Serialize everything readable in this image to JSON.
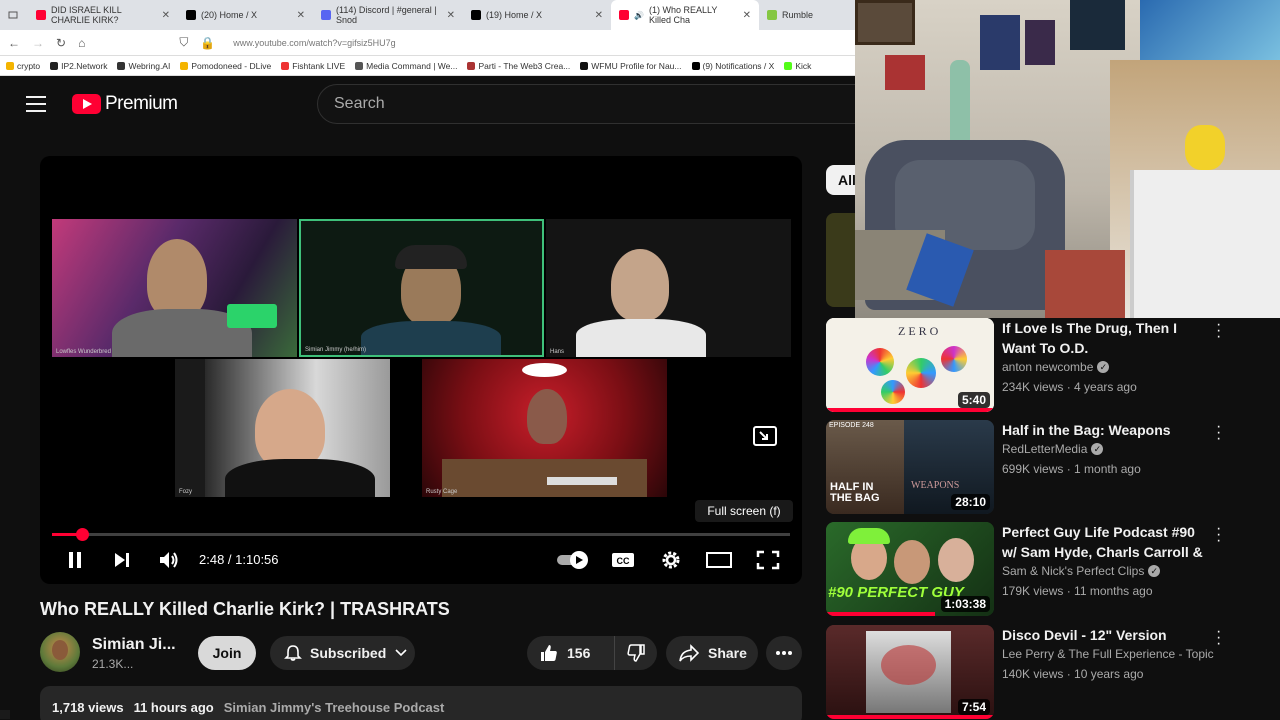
{
  "browser": {
    "tabs": [
      {
        "label": "DID ISRAEL KILL CHARLIE KIRK?"
      },
      {
        "label": "(20) Home / X"
      },
      {
        "label": "(114) Discord | #general | Snod"
      },
      {
        "label": "(19) Home / X"
      },
      {
        "label": "(1) Who REALLY Killed Cha"
      },
      {
        "label": "Rumble"
      }
    ],
    "url": "www.youtube.com/watch?v=gifsiz5HU7g",
    "bookmarks": [
      "crypto",
      "IP2.Network",
      "Webring.AI",
      "Pomodoneed - DLive",
      "Fishtank LIVE",
      "Media Command | We...",
      "Parti - The Web3 Crea...",
      "WFMU Profile for Nau...",
      "(9) Notifications / X",
      "Kick"
    ]
  },
  "header": {
    "logo_text": "Premium",
    "search_placeholder": "Search"
  },
  "player": {
    "participants": [
      "Lowfles Wunderbred",
      "Simian Jimmy (he/him)",
      "Hans",
      "Fozy",
      "Rusty Cage"
    ],
    "tooltip": "Full screen (f)",
    "time": "2:48 / 1:10:56",
    "progress": 0.04,
    "icons": [
      "pause-icon",
      "next-icon",
      "volume-icon",
      "autoplay-toggle-icon",
      "captions-icon",
      "settings-icon",
      "theater-icon",
      "fullscreen-icon",
      "miniplayer-icon"
    ]
  },
  "video": {
    "title": "Who REALLY Killed Charlie Kirk? | TRASHRATS",
    "channel": "Simian Ji...",
    "subscribers": "21.3K...",
    "join_label": "Join",
    "subscribed_label": "Subscribed",
    "likes": "156",
    "share_label": "Share",
    "views": "1,718 views",
    "age": "11 hours ago",
    "description_tag": "Simian Jimmy's Treehouse Podcast"
  },
  "sidebar": {
    "chip": "All",
    "recommendations": [
      {
        "title": "If Love Is The Drug, Then I Want To O.D.",
        "channel": "anton newcombe",
        "verified": true,
        "meta": "234K views · 4 years ago",
        "duration": "5:40",
        "thumb_text": "ZERO",
        "watched": 1.0
      },
      {
        "title": "Half in the Bag: Weapons",
        "channel": "RedLetterMedia",
        "verified": true,
        "meta": "699K views · 1 month ago",
        "duration": "28:10",
        "thumb_text": "HALF IN THE BAG",
        "thumb_text2": "WEAPONS",
        "thumb_text3": "EPISODE 248",
        "watched": 0
      },
      {
        "title": "Perfect Guy Life Podcast #90 w/ Sam Hyde, Charls Carroll & ...",
        "channel": "Sam & Nick's Perfect Clips",
        "verified": true,
        "meta": "179K views · 11 months ago",
        "duration": "1:03:38",
        "thumb_text": "#90 PERFECT GUY",
        "watched": 0.65
      },
      {
        "title": "Disco Devil - 12\" Version",
        "channel": "Lee Perry & The Full Experience - Topic",
        "verified": false,
        "meta": "140K views · 10 years ago",
        "duration": "7:54",
        "watched": 1.0
      }
    ]
  },
  "colors": {
    "accent": "#ff0033",
    "bg": "#0f0f0f",
    "surface": "#272727"
  }
}
